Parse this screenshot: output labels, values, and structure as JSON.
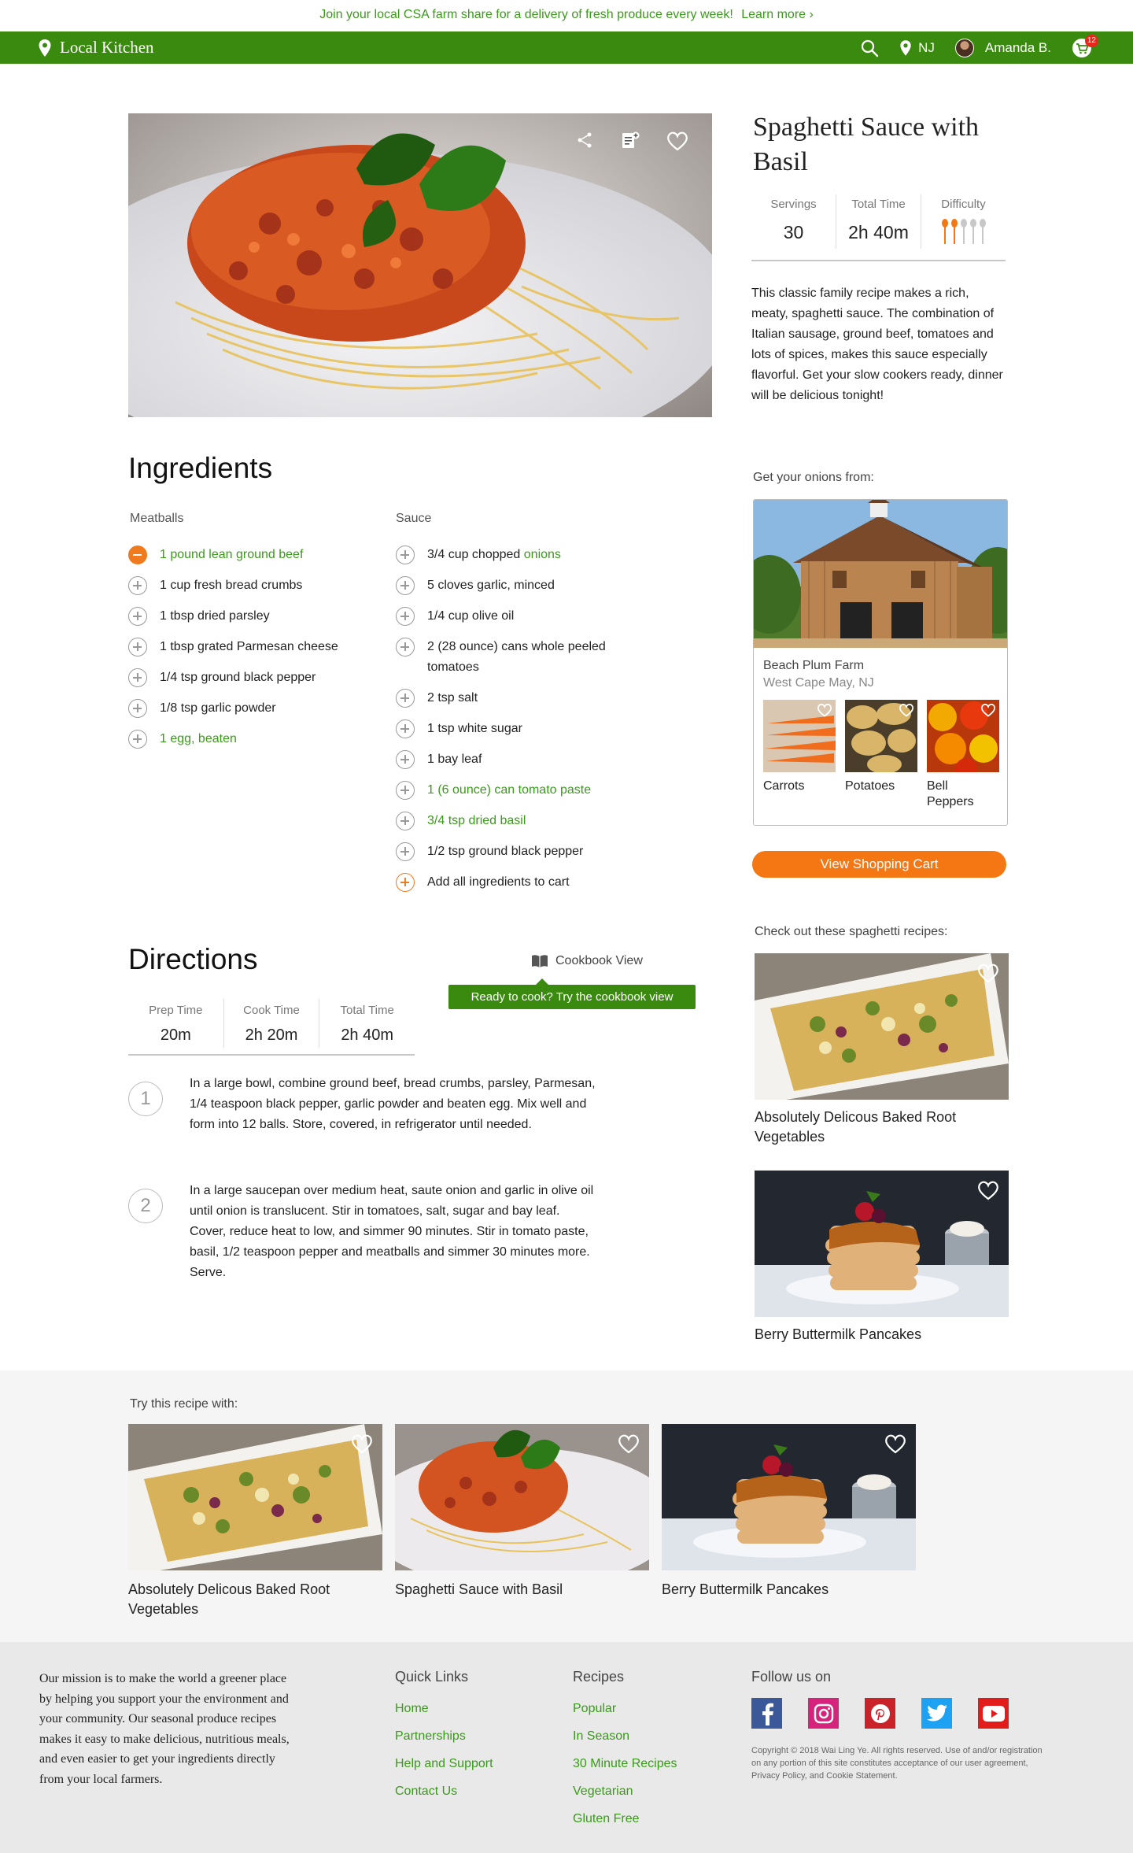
{
  "promo": {
    "text": "Join your local CSA farm share for a delivery of fresh produce every week!",
    "link": "Learn more ›"
  },
  "header": {
    "brand": "Local Kitchen",
    "location": "NJ",
    "user": "Amanda B.",
    "cart_count": "12"
  },
  "recipe": {
    "title": "Spaghetti Sauce with Basil",
    "stats": [
      {
        "label": "Servings",
        "value": "30"
      },
      {
        "label": "Total Time",
        "value": "2h 40m"
      },
      {
        "label": "Difficulty",
        "level": 2,
        "max": 5
      }
    ],
    "description": "This classic family recipe makes a rich, meaty, spaghetti sauce. The combination of Italian sausage, ground beef, tomatoes and lots of spices, makes this sauce especially flavorful. Get your slow cookers ready, dinner will be delicious tonight!"
  },
  "ingredients": {
    "title": "Ingredients",
    "meatballs": {
      "title": "Meatballs",
      "items": [
        "1 pound lean ground beef",
        "1 cup fresh bread crumbs",
        "1 tbsp dried parsley",
        "1 tbsp grated Parmesan cheese",
        "1/4 tsp ground black pepper",
        "1/8 tsp garlic powder",
        "1 egg, beaten"
      ]
    },
    "sauce": {
      "title": "Sauce",
      "items": [
        "3/4 cup chopped ",
        "onions",
        "5 cloves garlic, minced",
        "1/4 cup olive oil",
        "2 (28 ounce) cans whole peeled tomatoes",
        "2 tsp salt",
        "1 tsp white sugar",
        "1 bay leaf",
        "1 (6 ounce) can tomato paste",
        "3/4 tsp dried basil",
        "1/2 tsp ground black pepper",
        "Add all ingredients to cart"
      ]
    }
  },
  "farm": {
    "label": "Get your onions from:",
    "name": "Beach Plum Farm",
    "location": "West Cape May, NJ",
    "produce": [
      "Carrots",
      "Potatoes",
      "Bell Peppers"
    ],
    "cart_button": "View Shopping Cart"
  },
  "suggestions": {
    "label": "Check out these spaghetti recipes:",
    "items": [
      "Absolutely Delicous Baked Root Vegetables",
      "Berry Buttermilk Pancakes"
    ]
  },
  "directions": {
    "title": "Directions",
    "cookbook": "Cookbook View",
    "tooltip": "Ready to cook? Try the cookbook view",
    "stats": [
      {
        "label": "Prep Time",
        "value": "20m"
      },
      {
        "label": "Cook Time",
        "value": "2h 20m"
      },
      {
        "label": "Total Time",
        "value": "2h 40m"
      }
    ],
    "steps": [
      {
        "num": "1",
        "text": "In a large bowl, combine ground beef, bread crumbs, parsley, Parmesan, 1/4 teaspoon black pepper, garlic powder and beaten egg. Mix well and form into 12 balls. Store, covered, in refrigerator until needed."
      },
      {
        "num": "2",
        "text": "In a large saucepan over medium heat, saute onion and garlic in olive oil until onion is translucent. Stir in tomatoes, salt, sugar and bay leaf. Cover, reduce heat to low, and simmer 90 minutes. Stir in tomato paste, basil, 1/2 teaspoon pepper and meatballs and simmer 30 minutes more. Serve."
      }
    ]
  },
  "try": {
    "label": "Try this recipe with:",
    "items": [
      "Absolutely Delicous Baked Root Vegetables",
      "Spaghetti Sauce with Basil",
      "Berry Buttermilk Pancakes"
    ]
  },
  "footer": {
    "mission": "Our mission is to make the world a greener place by helping you support your the environment and your community. Our seasonal produce recipes makes it easy to make delicious, nutritious meals, and even easier to get your ingredients directly from your local farmers.",
    "quick_links": {
      "title": "Quick Links",
      "items": [
        "Home",
        "Partnerships",
        "Help and Support",
        "Contact Us"
      ]
    },
    "recipes": {
      "title": "Recipes",
      "items": [
        "Popular",
        "In Season",
        "30 Minute Recipes",
        "Vegetarian",
        "Gluten Free"
      ]
    },
    "follow": {
      "title": "Follow us on",
      "networks": [
        "facebook-icon",
        "instagram-icon",
        "pinterest-icon",
        "twitter-icon",
        "youtube-icon"
      ]
    },
    "copyright": "Copyright © 2018 Wai Ling Ye. All rights reserved. Use of and/or registration on any portion of this site constitutes acceptance of our user agreement, Privacy Policy, and Cookie Statement."
  },
  "colors": {
    "brand_green": "#3b8a10",
    "link_green": "#3a9a1a",
    "accent_orange": "#f57714",
    "badge_red": "#e8261c"
  }
}
